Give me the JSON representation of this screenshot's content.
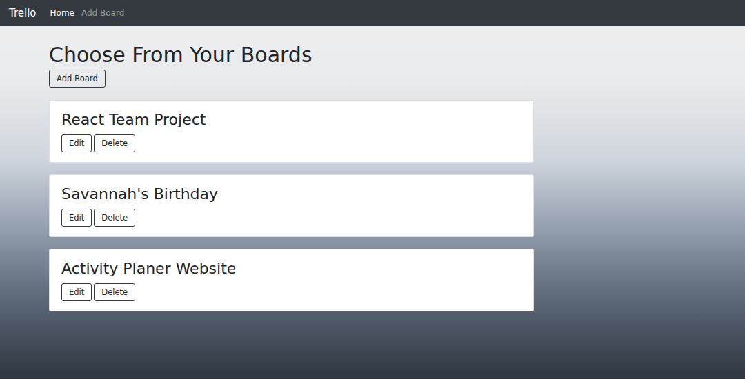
{
  "navbar": {
    "brand": "Trello",
    "links": [
      {
        "label": "Home",
        "selected": true
      },
      {
        "label": "Add Board",
        "selected": false
      }
    ]
  },
  "heading": "Choose From Your Boards",
  "add_button": "Add Board",
  "boards": [
    {
      "title": "React Team Project",
      "edit": "Edit",
      "delete": "Delete"
    },
    {
      "title": "Savannah's Birthday",
      "edit": "Edit",
      "delete": "Delete"
    },
    {
      "title": "Activity Planer Website",
      "edit": "Edit",
      "delete": "Delete"
    }
  ]
}
